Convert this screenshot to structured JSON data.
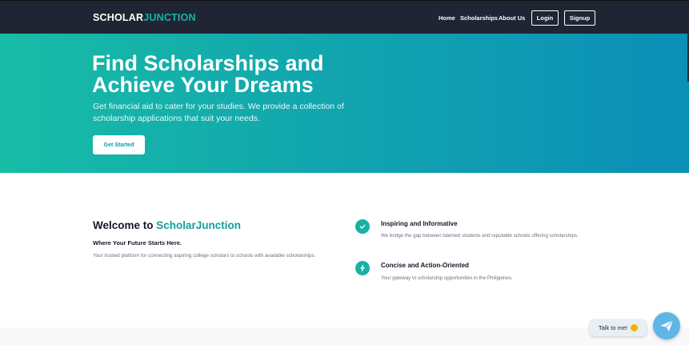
{
  "brand": {
    "part1": "SCHOLAR",
    "part2": "JUNCTION"
  },
  "nav": {
    "home": "Home",
    "scholarships": "Scholarships",
    "about": "About Us",
    "login": "Login",
    "signup": "Signup"
  },
  "hero": {
    "title": "Find Scholarships and Achieve Your Dreams",
    "subtitle": "Get financial aid to cater for your studies. We provide a collection of scholarship applications that suit your needs.",
    "cta": "Get Started"
  },
  "welcome": {
    "title_prefix": "Welcome to ",
    "title_accent": "ScholarJunction",
    "tagline": "Where Your Future Starts Here.",
    "description": "Your trusted platform for connecting aspiring college scholars to schools with available scholarships."
  },
  "features": [
    {
      "title": "Inspiring and Informative",
      "description": "We bridge the gap between talented students and reputable schools offering scholarships.",
      "icon": "check-icon"
    },
    {
      "title": "Concise and Action-Oriented",
      "description": "Your gateway to scholarship opportunities in the Philippines.",
      "icon": "lightning-icon"
    }
  ],
  "chat": {
    "label": "Talk to me!",
    "icon": "paper-plane-icon"
  },
  "colors": {
    "navbar": "#1f2533",
    "accent": "#16b5a3",
    "hero_start": "#17bca6",
    "hero_end": "#0b8fb8"
  }
}
